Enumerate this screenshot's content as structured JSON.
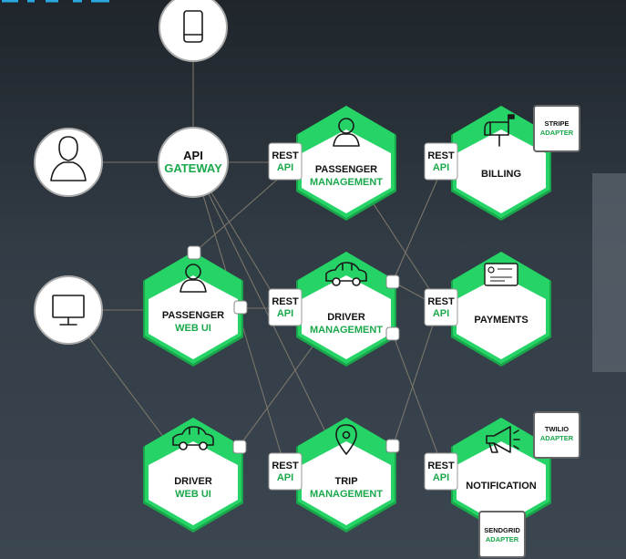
{
  "colors": {
    "accent": "#25d366",
    "accent_dark": "#1aa84b",
    "background": "#2b333b",
    "link": "#7a756a"
  },
  "clients": {
    "mobile": {
      "icon": "mobile-phone-icon"
    },
    "user": {
      "icon": "user-icon"
    },
    "desktop": {
      "icon": "desktop-monitor-icon"
    }
  },
  "gateway": {
    "line1": "API",
    "line2": "GATEWAY"
  },
  "rest_api": {
    "line1": "REST",
    "line2": "API"
  },
  "services": {
    "passenger_management": {
      "line1": "PASSENGER",
      "line2": "MANAGEMENT",
      "icon": "person-icon"
    },
    "billing": {
      "line1": "BILLING",
      "icon": "mailbox-icon"
    },
    "passenger_web_ui": {
      "line1": "PASSENGER",
      "line2": "WEB UI",
      "icon": "person-icon"
    },
    "driver_management": {
      "line1": "DRIVER",
      "line2": "MANAGEMENT",
      "icon": "car-icon"
    },
    "payments": {
      "line1": "PAYMENTS",
      "icon": "credit-card-icon"
    },
    "driver_web_ui": {
      "line1": "DRIVER",
      "line2": "WEB UI",
      "icon": "car-icon"
    },
    "trip_management": {
      "line1": "TRIP",
      "line2": "MANAGEMENT",
      "icon": "map-pin-icon"
    },
    "notification": {
      "line1": "NOTIFICATION",
      "icon": "megaphone-icon"
    }
  },
  "adapters": {
    "stripe": {
      "line1": "STRIPE",
      "line2": "ADAPTER"
    },
    "twilio": {
      "line1": "TWILIO",
      "line2": "ADAPTER"
    },
    "sendgrid": {
      "line1": "SENDGRID",
      "line2": "ADAPTER"
    }
  }
}
